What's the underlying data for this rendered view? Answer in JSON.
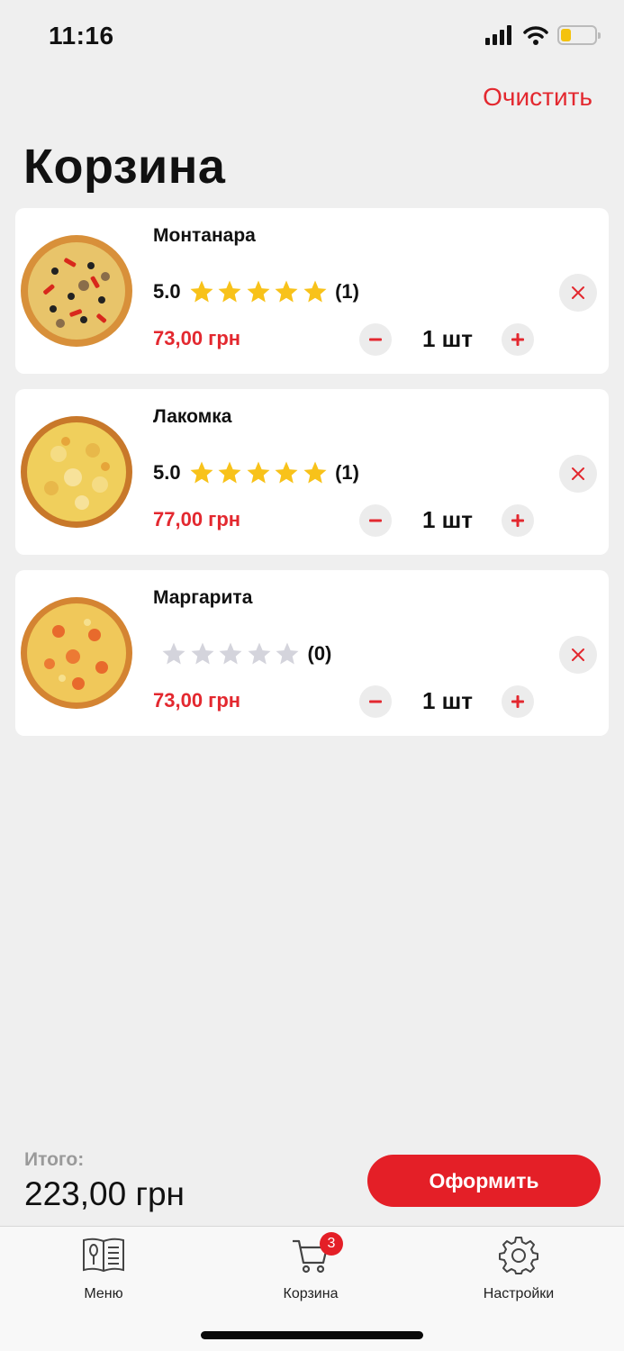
{
  "status_bar": {
    "time": "11:16"
  },
  "header": {
    "clear_label": "Очистить",
    "title": "Корзина"
  },
  "cart_items": [
    {
      "name": "Монтанара",
      "rating": "5.0",
      "stars_filled": 5,
      "rating_count": "(1)",
      "price": "73,00 грн",
      "quantity": "1 шт"
    },
    {
      "name": "Лакомка",
      "rating": "5.0",
      "stars_filled": 5,
      "rating_count": "(1)",
      "price": "77,00 грн",
      "quantity": "1 шт"
    },
    {
      "name": "Маргарита",
      "rating": "",
      "stars_filled": 0,
      "rating_count": "(0)",
      "price": "73,00 грн",
      "quantity": "1 шт"
    }
  ],
  "summary": {
    "total_label": "Итого:",
    "total_value": "223,00 грн",
    "checkout_label": "Оформить"
  },
  "tab_bar": {
    "menu_label": "Меню",
    "cart_label": "Корзина",
    "cart_badge": "3",
    "settings_label": "Настройки"
  },
  "colors": {
    "accent": "#e3282f",
    "star_filled": "#f8c21a",
    "star_empty": "#d4d4dc",
    "background": "#efefef"
  }
}
